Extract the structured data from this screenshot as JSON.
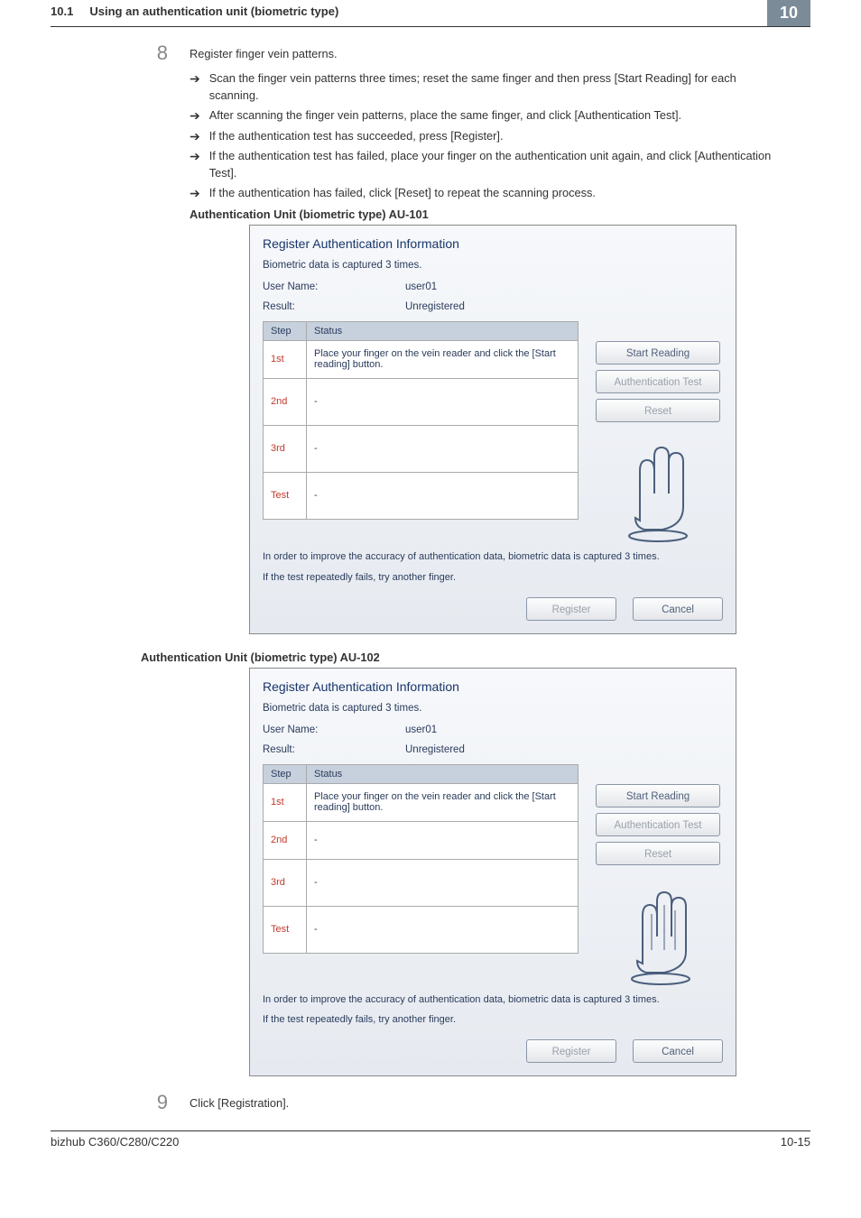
{
  "header": {
    "section": "10.1",
    "title": "Using an authentication unit (biometric type)",
    "chapter": "10"
  },
  "step8": {
    "num": "8",
    "text": "Register finger vein patterns.",
    "bullets": [
      "Scan the finger vein patterns three times; reset the same finger and then press [Start Reading] for each scanning.",
      "After scanning the finger vein patterns, place the same finger, and click [Authentication Test].",
      "If the authentication test has succeeded, press [Register].",
      "If the authentication test has failed, place your finger on the authentication unit again, and click [Authentication Test].",
      "If the authentication has failed, click [Reset] to repeat the scanning process."
    ],
    "caption101": "Authentication Unit (biometric type) AU-101",
    "caption102": "Authentication Unit (biometric type) AU-102"
  },
  "dialog": {
    "title": "Register Authentication Information",
    "intro": "Biometric data is captured 3 times.",
    "user_label": "User Name:",
    "user_value": "user01",
    "result_label": "Result:",
    "result_value": "Unregistered",
    "col_step": "Step",
    "col_status": "Status",
    "rows": {
      "r1_step": "1st",
      "r1_status": "Place your finger on the vein reader and click the [Start reading] button.",
      "r2_step": "2nd",
      "r2_status": "-",
      "r3_step": "3rd",
      "r3_status": "-",
      "r4_step": "Test",
      "r4_status": "-"
    },
    "note1": "In order to improve the accuracy of authentication data, biometric data is captured 3 times.",
    "note2": "If the test repeatedly fails, try another finger.",
    "btn_start": "Start Reading",
    "btn_auth": "Authentication Test",
    "btn_reset": "Reset",
    "btn_register": "Register",
    "btn_cancel": "Cancel"
  },
  "step9": {
    "num": "9",
    "text": "Click [Registration]."
  },
  "footer": {
    "model": "bizhub C360/C280/C220",
    "page": "10-15"
  }
}
